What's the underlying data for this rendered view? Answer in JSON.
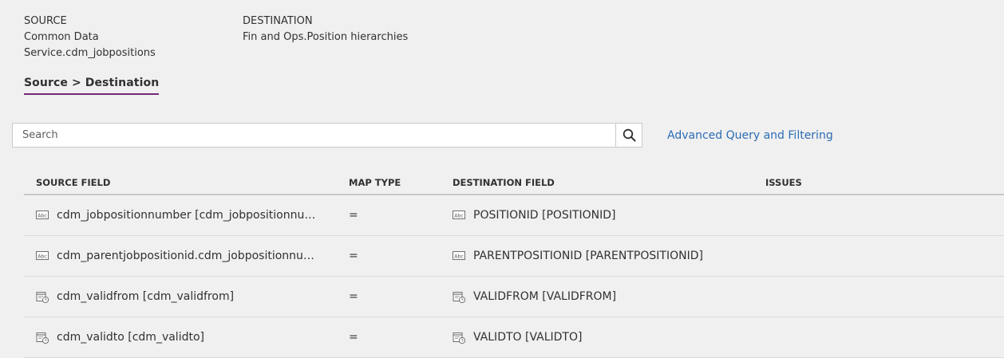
{
  "header": {
    "source_label": "SOURCE",
    "source_value_line1": "Common Data",
    "source_value_line2": "Service.cdm_jobpositions",
    "destination_label": "DESTINATION",
    "destination_value": "Fin and Ops.Position hierarchies"
  },
  "pivot": {
    "label": "Source > Destination"
  },
  "search": {
    "placeholder": "Search",
    "value": ""
  },
  "advanced_link": "Advanced Query and Filtering",
  "table": {
    "columns": [
      "SOURCE FIELD",
      "MAP TYPE",
      "DESTINATION FIELD",
      "ISSUES"
    ],
    "rows": [
      {
        "source_icon": "text-field-icon",
        "source": "cdm_jobpositionnumber [cdm_jobpositionnumb...",
        "map_type": "=",
        "dest_icon": "text-field-icon",
        "destination": "POSITIONID [POSITIONID]",
        "issues": ""
      },
      {
        "source_icon": "text-field-icon",
        "source": "cdm_parentjobpositionid.cdm_jobpositionnumb...",
        "map_type": "=",
        "dest_icon": "text-field-icon",
        "destination": "PARENTPOSITIONID [PARENTPOSITIONID]",
        "issues": ""
      },
      {
        "source_icon": "datetime-field-icon",
        "source": "cdm_validfrom [cdm_validfrom]",
        "map_type": "=",
        "dest_icon": "datetime-field-icon",
        "destination": "VALIDFROM [VALIDFROM]",
        "issues": ""
      },
      {
        "source_icon": "datetime-field-icon",
        "source": "cdm_validto [cdm_validto]",
        "map_type": "=",
        "dest_icon": "datetime-field-icon",
        "destination": "VALIDTO [VALIDTO]",
        "issues": ""
      }
    ]
  },
  "colors": {
    "accent": "#742774",
    "link": "#2b6cb5",
    "background": "#f0f0f0"
  }
}
